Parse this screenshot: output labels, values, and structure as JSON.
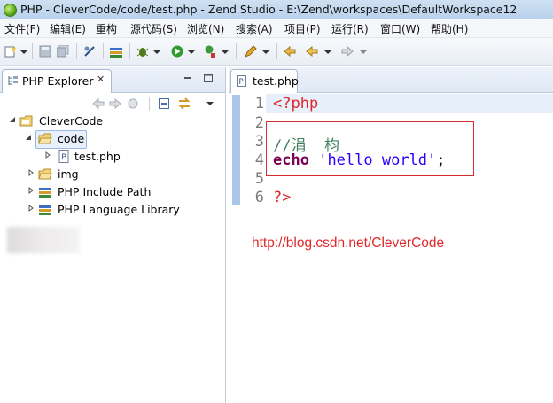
{
  "window": {
    "title": "PHP - CleverCode/code/test.php - Zend Studio - E:\\Zend\\workspaces\\DefaultWorkspace12"
  },
  "menu": [
    {
      "label": "文件(F)"
    },
    {
      "label": "编辑(E)"
    },
    {
      "label": "重构"
    },
    {
      "label": "源代码(S)"
    },
    {
      "label": "浏览(N)"
    },
    {
      "label": "搜索(A)"
    },
    {
      "label": "项目(P)"
    },
    {
      "label": "运行(R)"
    },
    {
      "label": "窗口(W)"
    },
    {
      "label": "帮助(H)"
    }
  ],
  "explorer": {
    "tab_label": "PHP Explorer",
    "close_glyph": "✕",
    "tree": {
      "project": "CleverCode",
      "items": [
        {
          "label": "code"
        },
        {
          "label": "test.php"
        },
        {
          "label": "img"
        },
        {
          "label": "PHP Include Path"
        },
        {
          "label": "PHP Language Library"
        }
      ]
    }
  },
  "editor": {
    "tab_label": "test.php",
    "line_numbers": [
      "1",
      "2",
      "3",
      "4",
      "5",
      "6"
    ],
    "code": {
      "line1": "<?php",
      "line3": "//涓  枃",
      "line4_keyword": "echo",
      "line4_string": "'hello world'",
      "line4_end": ";",
      "line6": "?>"
    },
    "overlay_url": "http://blog.csdn.net/CleverCode"
  },
  "colors": {
    "php_tag": "#e0282a",
    "keyword": "#7b0052",
    "string": "#2a00ff",
    "comment": "#3f7f5f",
    "highlight_box": "#d23030"
  }
}
